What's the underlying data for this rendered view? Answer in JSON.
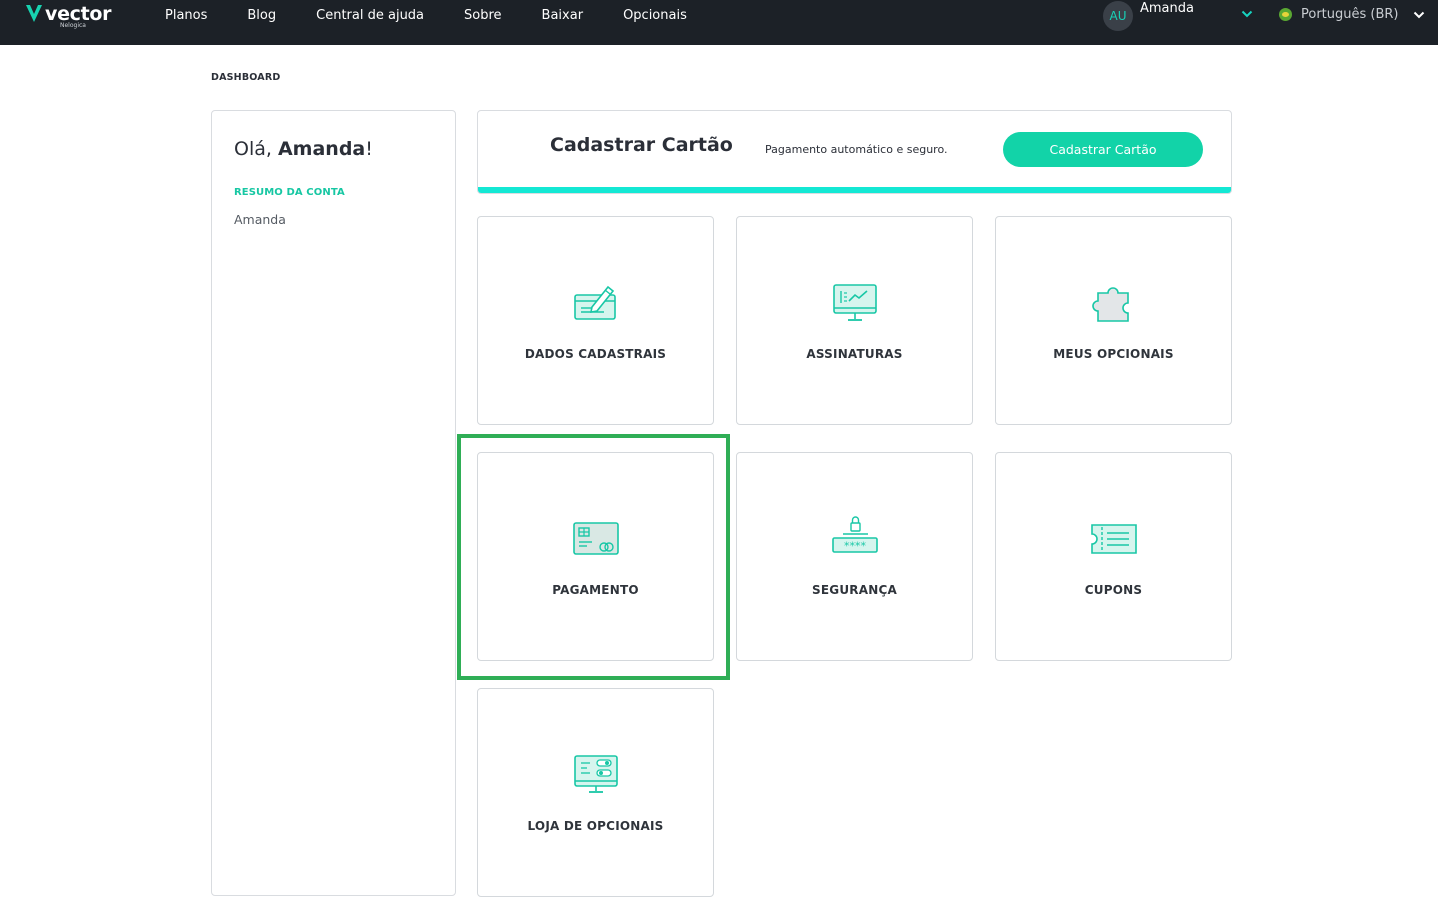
{
  "header": {
    "logo_text": "vector",
    "logo_sub": "Nelogica",
    "nav": [
      "Planos",
      "Blog",
      "Central de ajuda",
      "Sobre",
      "Baixar",
      "Opcionais"
    ],
    "user_initials": "AU",
    "user_name": "Amanda",
    "language": "Português (BR)"
  },
  "breadcrumb": "DASHBOARD",
  "sidebar": {
    "greeting": "Olá,",
    "greeting_name": "Amanda",
    "greeting_end": "!",
    "section": "RESUMO DA CONTA",
    "account_name": "Amanda"
  },
  "banner": {
    "title": "Cadastrar Cartão",
    "description": "Pagamento automático e seguro.",
    "button": "Cadastrar Cartão"
  },
  "cards": [
    {
      "label": "DADOS CADASTRAIS",
      "icon": "card-edit-icon"
    },
    {
      "label": "ASSINATURAS",
      "icon": "monitor-chart-icon"
    },
    {
      "label": "MEUS OPCIONAIS",
      "icon": "puzzle-icon"
    },
    {
      "label": "PAGAMENTO",
      "icon": "credit-card-icon"
    },
    {
      "label": "SEGURANÇA",
      "icon": "lock-password-icon"
    },
    {
      "label": "CUPONS",
      "icon": "ticket-icon"
    },
    {
      "label": "LOJA DE OPCIONAIS",
      "icon": "monitor-toggles-icon"
    }
  ],
  "colors": {
    "accent": "#12d3a8",
    "icon_stroke": "#18c7a6",
    "highlight": "#2fae56",
    "header_bg": "#1c2127"
  }
}
